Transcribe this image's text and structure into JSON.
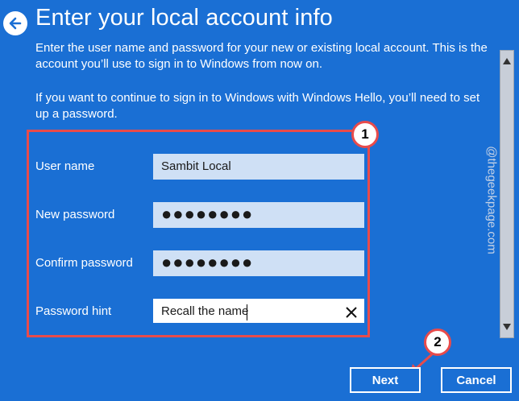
{
  "header": {
    "back_icon": "back-arrow-icon",
    "title": "Enter your local account info"
  },
  "description": {
    "paragraph1": "Enter the user name and password for your new or existing local account. This is the account you’ll use to sign in to Windows from now on.",
    "paragraph2": "If you want to continue to sign in to Windows with Windows Hello, you’ll need to set up a password."
  },
  "form": {
    "fields": [
      {
        "label": "User name",
        "value": "Sambit Local"
      },
      {
        "label": "New password",
        "value": "●●●●●●●●"
      },
      {
        "label": "Confirm password",
        "value": "●●●●●●●●"
      },
      {
        "label": "Password hint",
        "value": "Recall the name"
      }
    ]
  },
  "annotations": {
    "badge1": "1",
    "badge2": "2",
    "highlight_color": "#e84b4b"
  },
  "watermark": "@thegeekpage.com",
  "buttons": {
    "next": "Next",
    "cancel": "Cancel"
  },
  "colors": {
    "background": "#1a6fd4",
    "input_fill": "#cfe0f5",
    "accent_red": "#e84b4b"
  }
}
